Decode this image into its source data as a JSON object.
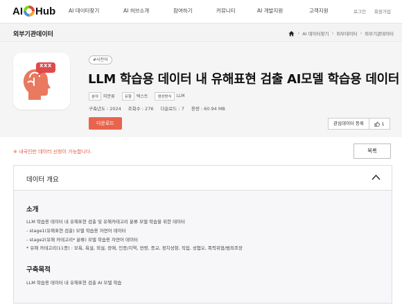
{
  "header": {
    "logo_prefix": "AI",
    "logo_suffix": "Hub",
    "nav": [
      "AI 데이터찾기",
      "AI 허브소개",
      "참여하기",
      "커뮤니티",
      "AI 개발지원",
      "고객지원"
    ],
    "util": [
      "로그인",
      "회원가입"
    ]
  },
  "subbar": {
    "title": "외부기관데이터",
    "breadcrumb": [
      "AI 데이터찾기",
      "외부데이터",
      "외부기관데이터"
    ]
  },
  "dataset": {
    "chip": "#사전어",
    "title": "LLM 학습용 데이터 내 유해표현 검출 AI모델 학습용 데이터",
    "meta": [
      {
        "key": "분야",
        "value": "미분류"
      },
      {
        "key": "유형",
        "value": "텍스트"
      },
      {
        "key": "생성방식",
        "value": "LLM"
      }
    ],
    "stats": [
      "구축년도 : 2024",
      "조회수 : 276",
      "다운로드 : 7",
      "용량 : 60.94 MB"
    ],
    "download_label": "다운로드",
    "interest_label": "관심데이터 등록",
    "like_count": "1",
    "thumb_badge": "XXX"
  },
  "notice": "※ 내국인만 데이터 신청이 가능합니다.",
  "list_label": "목록",
  "overview": {
    "heading": "데이터 개요",
    "intro_title": "소개",
    "intro_lines": [
      "LLM 학습용 데이터 내 유해표현 검출 및 유해카테고리 분류 모델 학습을 위한 데이터",
      " - stage1(유해표현 검출) 모델 학습용 자연어 데이터",
      " - stage2(유해 카테고리* 분류) 모델 학습용 자연어 데이터",
      "   * 유해 카테고리(11종) : 모욕, 욕설, 외설, 장애, 인종/지역, 연령, 종교, 정치성향, 직업, 성혐오, 폭력위협/범죄조장"
    ],
    "purpose_title": "구축목적",
    "purpose_text": "LLM 학습용 데이터 내 유해표현 검출 AI 모델 학습"
  },
  "colors": {
    "accent": "#e9644d",
    "notice": "#e05a3d",
    "thumb_icon": "#e04a4a"
  }
}
